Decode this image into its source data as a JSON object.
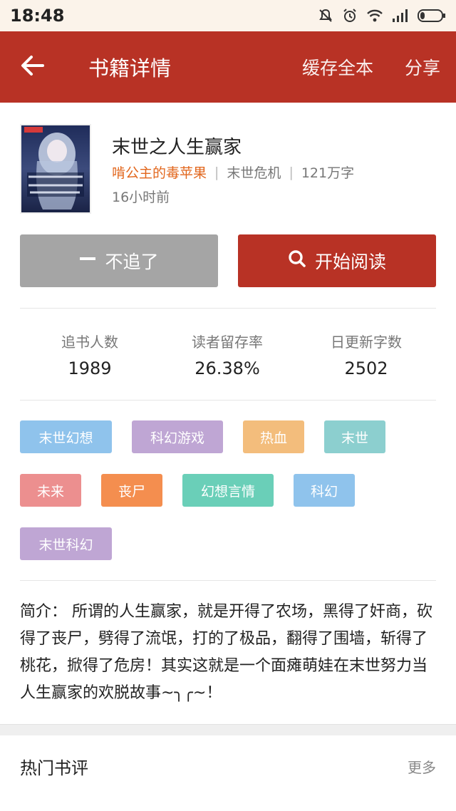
{
  "status_bar": {
    "time": "18:48"
  },
  "app_bar": {
    "title": "书籍详情",
    "cache_all": "缓存全本",
    "share": "分享"
  },
  "book": {
    "title": "末世之人生赢家",
    "author": "啃公主的毒苹果",
    "category": "末世危机",
    "word_count": "121万字",
    "updated": "16小时前",
    "cover_text": "末世之人生赢家"
  },
  "actions": {
    "unfollow": "不追了",
    "start_reading": "开始阅读"
  },
  "stats": [
    {
      "label": "追书人数",
      "value": "1989"
    },
    {
      "label": "读者留存率",
      "value": "26.38%"
    },
    {
      "label": "日更新字数",
      "value": "2502"
    }
  ],
  "tags": [
    {
      "label": "末世幻想",
      "color": "#8fc3ec"
    },
    {
      "label": "科幻游戏",
      "color": "#bfa6d4"
    },
    {
      "label": "热血",
      "color": "#f3bd7c"
    },
    {
      "label": "末世",
      "color": "#8ccfcf"
    },
    {
      "label": "未来",
      "color": "#ec8f8f"
    },
    {
      "label": "丧尸",
      "color": "#f48e4f"
    },
    {
      "label": "幻想言情",
      "color": "#6acfb8"
    },
    {
      "label": "科幻",
      "color": "#8fc3ec"
    },
    {
      "label": "末世科幻",
      "color": "#bfa6d4"
    }
  ],
  "synopsis": {
    "label": "简介：",
    "text": "所谓的人生赢家，就是开得了农场，黑得了奸商，砍得了丧尸，劈得了流氓，打的了极品，翻得了围墙，斩得了桃花，掀得了危房！其实这就是一个面瘫萌娃在末世努力当人生赢家的欢脱故事~╮╭~！"
  },
  "reviews": {
    "title": "热门书评",
    "more": "更多"
  },
  "colors": {
    "brand": "#b83225",
    "author": "#e2661c",
    "status_bg": "#fbf3ea"
  },
  "icons": [
    "back-arrow-icon",
    "search-icon",
    "minus-icon",
    "wifi-icon",
    "signal-icon",
    "battery-icon",
    "alarm-icon",
    "mute-icon"
  ]
}
